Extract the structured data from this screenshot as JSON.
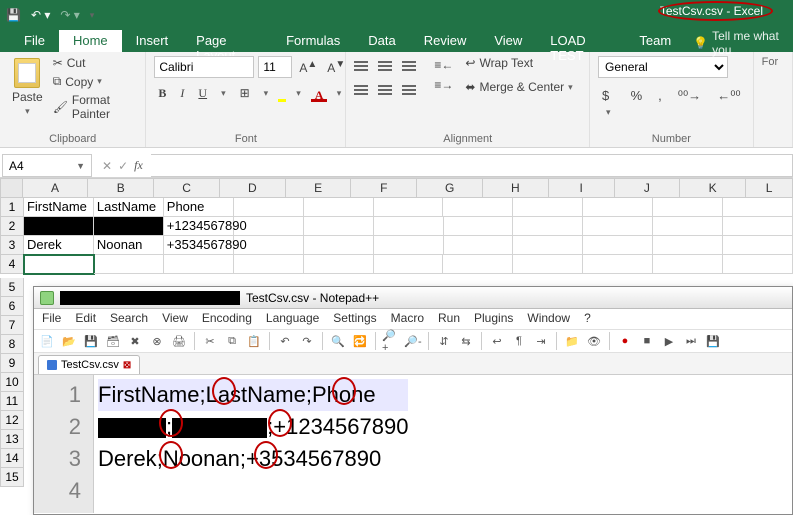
{
  "app": {
    "title": "TestCsv.csv - Excel"
  },
  "ribbon": {
    "tabs": [
      "File",
      "Home",
      "Insert",
      "Page Layout",
      "Formulas",
      "Data",
      "Review",
      "View",
      "LOAD TEST",
      "Team"
    ],
    "active_tab": "Home",
    "tellme": "Tell me what you",
    "clipboard": {
      "paste": "Paste",
      "cut": "Cut",
      "copy": "Copy",
      "painter": "Format Painter",
      "title": "Clipboard"
    },
    "font": {
      "name": "Calibri",
      "size": "11",
      "title": "Font"
    },
    "alignment": {
      "wrap": "Wrap Text",
      "merge": "Merge & Center",
      "title": "Alignment"
    },
    "number": {
      "format": "General",
      "title": "Number"
    }
  },
  "namebox": "A4",
  "columns": [
    "A",
    "B",
    "C",
    "D",
    "E",
    "F",
    "G",
    "H",
    "I",
    "J",
    "K",
    "L"
  ],
  "chart_data": {
    "type": "table",
    "columns": [
      "FirstName",
      "LastName",
      "Phone"
    ],
    "rows": [
      {
        "FirstName": "[redacted]",
        "LastName": "[redacted]",
        "Phone": "+1234567890"
      },
      {
        "FirstName": "Derek",
        "LastName": "Noonan",
        "Phone": "+3534567890"
      }
    ]
  },
  "sheet": {
    "header": {
      "a": "FirstName",
      "b": "LastName",
      "c": "Phone"
    },
    "r2": {
      "c": "+1234567890"
    },
    "r3": {
      "a": "Derek",
      "b": "Noonan",
      "c": "+3534567890"
    }
  },
  "npp": {
    "title_suffix": "TestCsv.csv - Notepad++",
    "menu": [
      "File",
      "Edit",
      "Search",
      "View",
      "Encoding",
      "Language",
      "Settings",
      "Macro",
      "Run",
      "Plugins",
      "Window",
      "?"
    ],
    "tab": "TestCsv.csv",
    "lines": {
      "l1_a": "FirstName",
      "l1_b": "LastName",
      "l1_c": "Phone",
      "l2_c": "+1234567890",
      "l3_a": "Derek",
      "l3_b": "Noonan",
      "l3_c": "+3534567890",
      "sep": ";"
    },
    "gutter": [
      "1",
      "2",
      "3",
      "4"
    ]
  }
}
